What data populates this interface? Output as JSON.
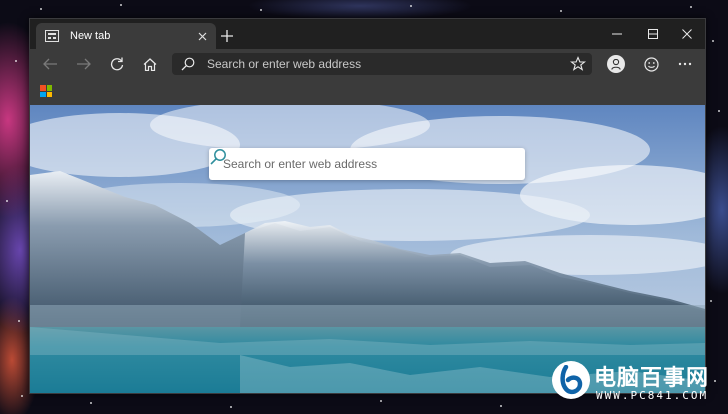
{
  "tab": {
    "title": "New tab"
  },
  "address_bar": {
    "placeholder": "Search or enter web address"
  },
  "new_tab_page": {
    "search_placeholder": "Search or enter web address"
  },
  "colors": {
    "titlebar": "#202020",
    "toolbar": "#3b3b3b",
    "tab_active": "#3b3b3b",
    "search_icon": "#2f8f9d",
    "ms_red": "#f25022",
    "ms_green": "#7fba00",
    "ms_blue": "#00a4ef",
    "ms_yellow": "#ffb900"
  },
  "icons": {
    "tab": "tab-page-icon",
    "close": "close-icon",
    "new_tab": "plus-icon",
    "back": "back-arrow-icon",
    "forward": "forward-arrow-icon",
    "refresh": "refresh-icon",
    "home": "home-icon",
    "search": "search-icon",
    "favorite": "star-icon",
    "profile": "profile-icon",
    "feedback": "smiley-icon",
    "menu": "more-icon"
  },
  "watermark": {
    "brand": "电脑百事网",
    "url": "WWW.PC841.COM"
  }
}
